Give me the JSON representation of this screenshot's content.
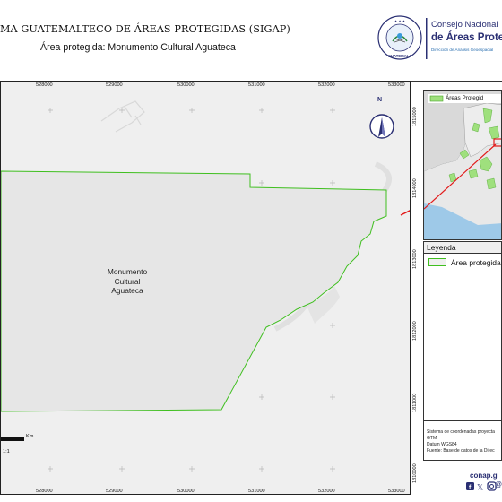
{
  "header": {
    "title": "MA GUATEMALTECO DE ÁREAS PROTEGIDAS  (SIGAP)",
    "subtitle": "Área protegida: Monumento Cultural Aguateca"
  },
  "seal": {
    "ring_text": "GOBIERNO DE LA REPÚBLICA",
    "bottom_text": "GUATEMALA"
  },
  "conap": {
    "line1": "Consejo Nacional",
    "line2": "de Áreas Protegid",
    "line3": "Dirección de Análisis Geoespacial"
  },
  "map": {
    "area_label": [
      "Monumento",
      "Cultural",
      "Aguateca"
    ],
    "x_ticks": [
      "528000",
      "529000",
      "530000",
      "531000",
      "532000",
      "533000"
    ],
    "y_ticks": [
      "1815000",
      "1814000",
      "1813000",
      "1812000",
      "1811000",
      "1810000"
    ],
    "north_label": "N",
    "scale_unit": "Km",
    "scale_ratio": "1:1",
    "colors": {
      "boundary": "#3fbf1f",
      "inset_line": "#e21b1b",
      "water": "#9ec9e8"
    }
  },
  "inset": {
    "legend_label": "Áreas Protegid"
  },
  "legend": {
    "title": "Leyenda",
    "item_label": "Área protegida"
  },
  "metadata": {
    "lines": [
      "Sistema de coordenadas proyecta",
      "GTM",
      "Datum WGS84",
      "Fuente: Base de datos de la Direc"
    ]
  },
  "footer": {
    "website": "conap.g",
    "social_icons": [
      "facebook-icon",
      "x-icon",
      "instagram-icon"
    ],
    "handle": "@"
  }
}
